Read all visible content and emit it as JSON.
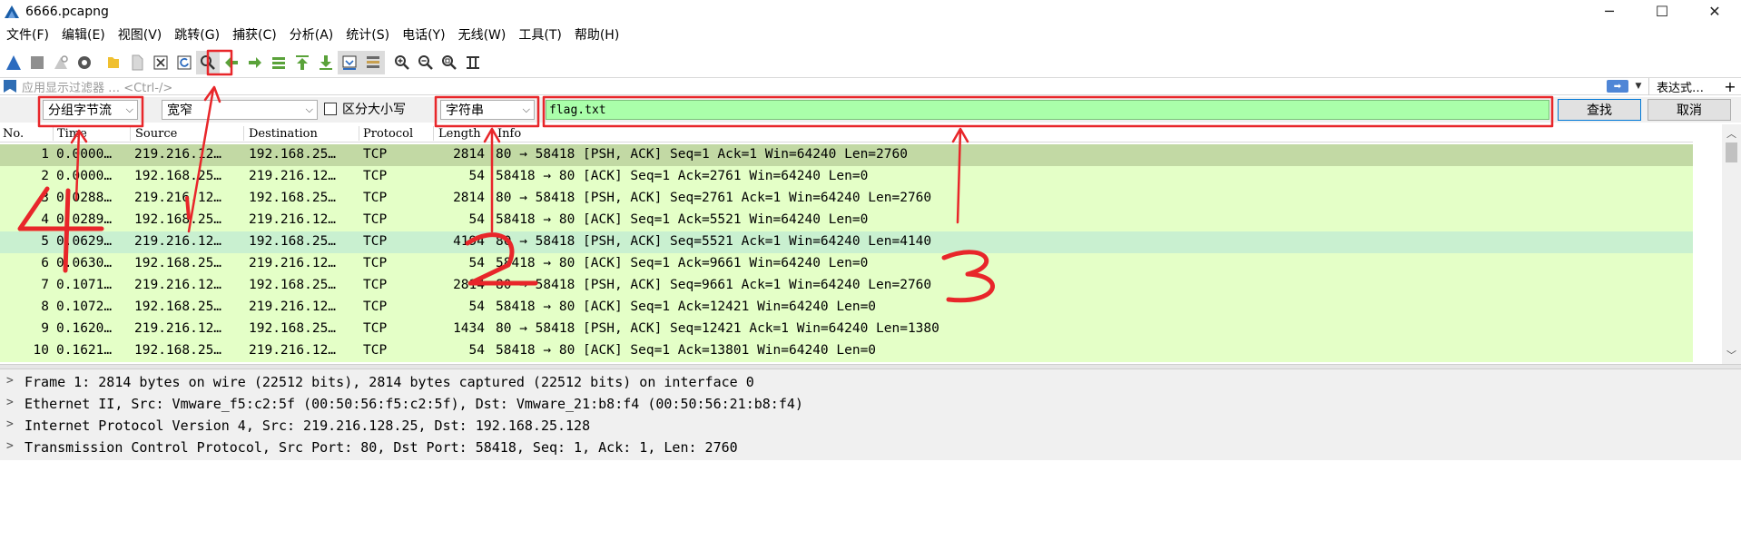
{
  "window": {
    "title": "6666.pcapng",
    "controls": [
      "─",
      "☐",
      "✕"
    ],
    "controls_icons": [
      "minimize-icon",
      "restore-icon",
      "close-icon"
    ]
  },
  "menu": [
    "文件(F)",
    "编辑(E)",
    "视图(V)",
    "跳转(G)",
    "捕获(C)",
    "分析(A)",
    "统计(S)",
    "电话(Y)",
    "无线(W)",
    "工具(T)",
    "帮助(H)"
  ],
  "toolbar_icons": [
    "start-capture-icon",
    "stop-capture-icon",
    "restart-capture-icon",
    "capture-options-icon",
    "open-file-icon",
    "save-file-icon",
    "close-file-icon",
    "reload-file-icon",
    "find-packet-icon",
    "go-back-icon",
    "go-forward-icon",
    "go-to-packet-icon",
    "first-packet-icon",
    "last-packet-icon",
    "autoscroll-icon",
    "colorize-icon",
    "zoom-in-icon",
    "zoom-out-icon",
    "normal-size-icon",
    "resize-columns-icon"
  ],
  "display_filter": {
    "placeholder": "应用显示过滤器 … <Ctrl-/>",
    "expression_label": "表达式…",
    "plus_label": "+"
  },
  "find_bar": {
    "search_in": "分组字节流",
    "char_width": "宽窄",
    "case_sensitive_label": "区分大小写",
    "search_type": "字符串",
    "search_value": "flag.txt",
    "find_label": "查找",
    "cancel_label": "取消"
  },
  "packet_list": {
    "columns": [
      "No.",
      "Time",
      "Source",
      "Destination",
      "Protocol",
      "Length",
      "Info"
    ],
    "rows": [
      {
        "no": "1",
        "time": "0.0000…",
        "src": "219.216.12…",
        "dst": "192.168.25…",
        "proto": "TCP",
        "len": "2814",
        "info": "80 → 58418 [PSH, ACK] Seq=1 Ack=1 Win=64240 Len=2760"
      },
      {
        "no": "2",
        "time": "0.0000…",
        "src": "192.168.25…",
        "dst": "219.216.12…",
        "proto": "TCP",
        "len": "54",
        "info": "58418 → 80 [ACK] Seq=1 Ack=2761 Win=64240 Len=0"
      },
      {
        "no": "3",
        "time": "0.0288…",
        "src": "219.216.12…",
        "dst": "192.168.25…",
        "proto": "TCP",
        "len": "2814",
        "info": "80 → 58418 [PSH, ACK] Seq=2761 Ack=1 Win=64240 Len=2760"
      },
      {
        "no": "4",
        "time": "0.0289…",
        "src": "192.168.25…",
        "dst": "219.216.12…",
        "proto": "TCP",
        "len": "54",
        "info": "58418 → 80 [ACK] Seq=1 Ack=5521 Win=64240 Len=0"
      },
      {
        "no": "5",
        "time": "0.0629…",
        "src": "219.216.12…",
        "dst": "192.168.25…",
        "proto": "TCP",
        "len": "4194",
        "info": "80 → 58418 [PSH, ACK] Seq=5521 Ack=1 Win=64240 Len=4140"
      },
      {
        "no": "6",
        "time": "0.0630…",
        "src": "192.168.25…",
        "dst": "219.216.12…",
        "proto": "TCP",
        "len": "54",
        "info": "58418 → 80 [ACK] Seq=1 Ack=9661 Win=64240 Len=0"
      },
      {
        "no": "7",
        "time": "0.1071…",
        "src": "219.216.12…",
        "dst": "192.168.25…",
        "proto": "TCP",
        "len": "2814",
        "info": "80 → 58418 [PSH, ACK] Seq=9661 Ack=1 Win=64240 Len=2760"
      },
      {
        "no": "8",
        "time": "0.1072…",
        "src": "192.168.25…",
        "dst": "219.216.12…",
        "proto": "TCP",
        "len": "54",
        "info": "58418 → 80 [ACK] Seq=1 Ack=12421 Win=64240 Len=0"
      },
      {
        "no": "9",
        "time": "0.1620…",
        "src": "219.216.12…",
        "dst": "192.168.25…",
        "proto": "TCP",
        "len": "1434",
        "info": "80 → 58418 [PSH, ACK] Seq=12421 Ack=1 Win=64240 Len=1380"
      },
      {
        "no": "10",
        "time": "0.1621…",
        "src": "192.168.25…",
        "dst": "219.216.12…",
        "proto": "TCP",
        "len": "54",
        "info": "58418 → 80 [ACK] Seq=1 Ack=13801 Win=64240 Len=0"
      }
    ]
  },
  "details": [
    "Frame 1: 2814 bytes on wire (22512 bits), 2814 bytes captured (22512 bits) on interface 0",
    "Ethernet II, Src: Vmware_f5:c2:5f (00:50:56:f5:c2:5f), Dst: Vmware_21:b8:f4 (00:50:56:21:b8:f4)",
    "Internet Protocol Version 4, Src: 219.216.128.25, Dst: 192.168.25.128",
    "Transmission Control Protocol, Src Port: 80, Dst Port: 58418, Seq: 1, Ack: 1, Len: 2760"
  ],
  "colors": {
    "row_default": "#e4ffc7",
    "row_selected": "#c2d9a4",
    "row_highlight": "#c9f0d0",
    "search_field": "#aaffaa",
    "annotation": "#e8262a"
  }
}
